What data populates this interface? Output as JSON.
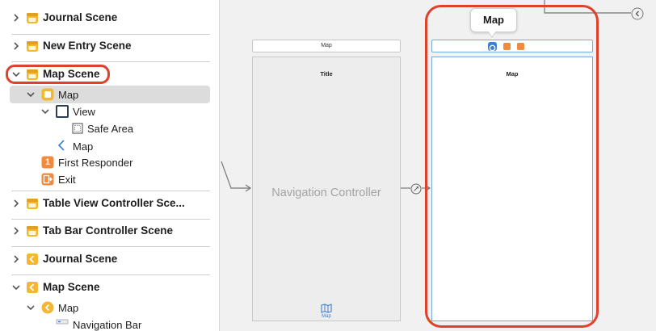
{
  "outline": {
    "rows": [
      {
        "key": "journal-scene-1",
        "label": "Journal Scene"
      },
      {
        "key": "new-entry-scene",
        "label": "New Entry Scene"
      },
      {
        "key": "map-scene-1",
        "label": "Map Scene"
      },
      {
        "key": "map-vc",
        "label": "Map"
      },
      {
        "key": "view",
        "label": "View"
      },
      {
        "key": "safe-area",
        "label": "Safe Area"
      },
      {
        "key": "map-nav-item",
        "label": "Map"
      },
      {
        "key": "first-responder",
        "label": "First Responder"
      },
      {
        "key": "exit",
        "label": "Exit"
      },
      {
        "key": "table-view-scene",
        "label": "Table View Controller Sce..."
      },
      {
        "key": "tab-bar-scene",
        "label": "Tab Bar Controller Scene"
      },
      {
        "key": "journal-scene-2",
        "label": "Journal Scene"
      },
      {
        "key": "map-scene-2",
        "label": "Map Scene"
      },
      {
        "key": "map-2",
        "label": "Map"
      },
      {
        "key": "navigation-bar",
        "label": "Navigation Bar"
      }
    ],
    "first_responder_badge": "1"
  },
  "canvas": {
    "nav_bar_title": "Map",
    "nav_controller_title": "Title",
    "nav_controller_name": "Navigation Controller",
    "tab_item_label": "Map",
    "map_vc_title": "Map",
    "tooltip": "Map"
  },
  "colors": {
    "scene_yellow": "#f5b731",
    "accent_blue": "#3d7fd6",
    "highlight_red": "#e0412c",
    "orange": "#f08a3c"
  }
}
